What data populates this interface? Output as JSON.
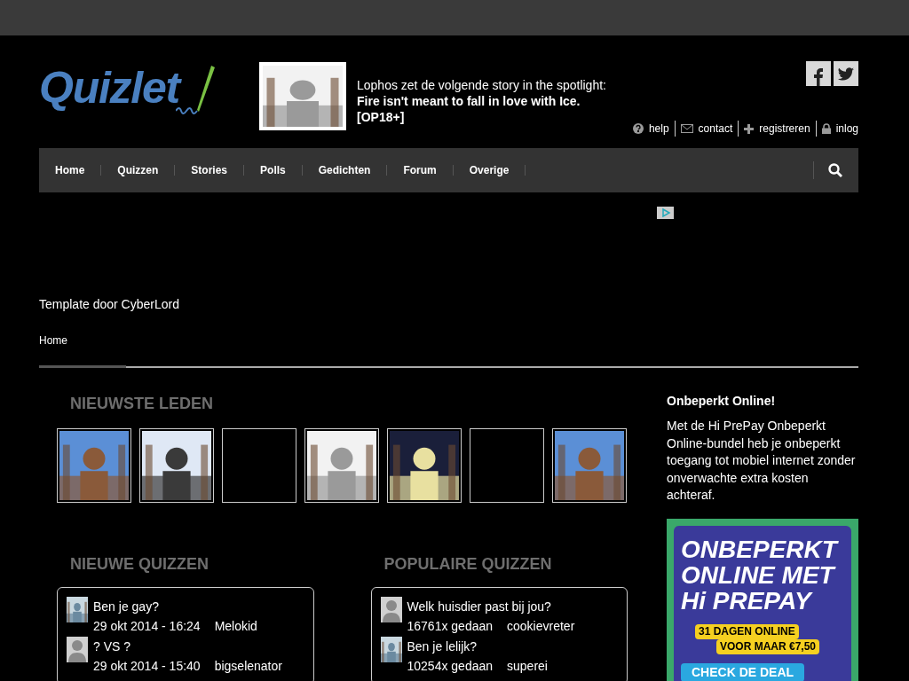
{
  "logo": {
    "text": "Quizlet"
  },
  "spotlight": {
    "intro": "Lophos zet de volgende story in the spotlight:",
    "title": "Fire isn't meant to fall in love with Ice. [OP18+]"
  },
  "social": [
    {
      "kind": "facebook"
    },
    {
      "kind": "twitter"
    }
  ],
  "user_links": [
    {
      "kind": "help",
      "label": "help"
    },
    {
      "kind": "contact",
      "label": "contact"
    },
    {
      "kind": "register",
      "label": "registreren"
    },
    {
      "kind": "login",
      "label": "inlog"
    }
  ],
  "nav": [
    {
      "label": "Home"
    },
    {
      "label": "Quizzen"
    },
    {
      "label": "Stories"
    },
    {
      "label": "Polls"
    },
    {
      "label": "Gedichten"
    },
    {
      "label": "Forum"
    },
    {
      "label": "Overige"
    }
  ],
  "credit": "Template door CyberLord",
  "breadcrumb": "Home",
  "newest_members": {
    "title": "NIEUWSTE LEDEN",
    "members": [
      {
        "kind": "picture"
      },
      {
        "kind": "picture"
      },
      {
        "kind": "empty"
      },
      {
        "kind": "picture"
      },
      {
        "kind": "picture"
      },
      {
        "kind": "empty"
      },
      {
        "kind": "picture"
      }
    ]
  },
  "new_quizzes": {
    "title": "NIEUWE QUIZZEN",
    "items": [
      {
        "kind": "picture",
        "title": "Ben je gay?",
        "meta": "29 okt 2014 - 16:24",
        "user": "Melokid"
      },
      {
        "kind": "silhouette",
        "title": "? VS ?",
        "meta": "29 okt 2014 - 15:40",
        "user": "bigselenator"
      }
    ]
  },
  "popular_quizzes": {
    "title": "POPULAIRE QUIZZEN",
    "items": [
      {
        "kind": "silhouette",
        "title": "Welk huisdier past bij jou?",
        "meta": "16761x gedaan",
        "user": "cookievreter"
      },
      {
        "kind": "picture",
        "title": "Ben je lelijk?",
        "meta": "10254x gedaan",
        "user": "superei"
      }
    ]
  },
  "sidebar": {
    "title": "Onbeperkt Online!",
    "text": "Met de Hi PrePay Onbeperkt Online-bundel heb je onbeperkt toegang tot mobiel internet zonder onverwachte extra kosten achteraf.",
    "ad": {
      "headline": "ONBEPERKT ONLINE MET Hi PREPAY",
      "offer_line_1": "31 DAGEN ONLINE",
      "offer_line_2": "VOOR MAAR €7,50",
      "cta": "CHECK DE DEAL"
    }
  }
}
